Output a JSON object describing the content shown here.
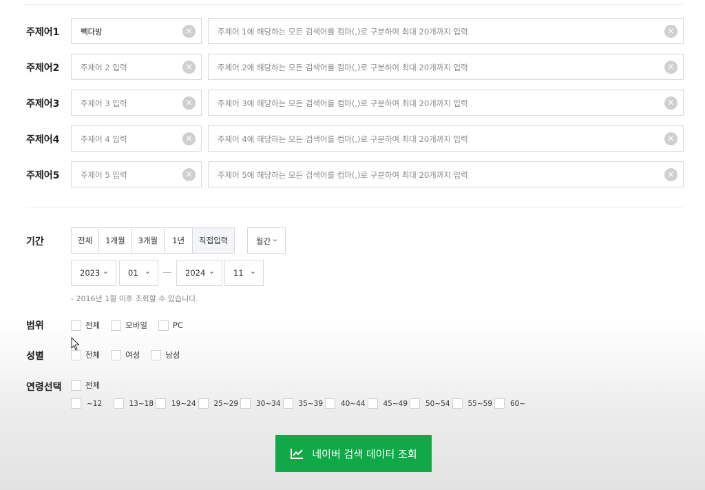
{
  "keywords": [
    {
      "label": "주제어1",
      "topic_value": "빽다방",
      "topic_placeholder": "주제어 1 입력",
      "terms_placeholder": "주제어 1에 해당하는 모든 검색어를 컴마(,)로 구분하여 최대 20개까지 입력"
    },
    {
      "label": "주제어2",
      "topic_value": "",
      "topic_placeholder": "주제어 2 입력",
      "terms_placeholder": "주제어 2에 해당하는 모든 검색어를 컴마(,)로 구분하여 최대 20개까지 입력"
    },
    {
      "label": "주제어3",
      "topic_value": "",
      "topic_placeholder": "주제어 3 입력",
      "terms_placeholder": "주제어 3에 해당하는 모든 검색어를 컴마(,)로 구분하여 최대 20개까지 입력"
    },
    {
      "label": "주제어4",
      "topic_value": "",
      "topic_placeholder": "주제어 4 입력",
      "terms_placeholder": "주제어 4에 해당하는 모든 검색어를 컴마(,)로 구분하여 최대 20개까지 입력"
    },
    {
      "label": "주제어5",
      "topic_value": "",
      "topic_placeholder": "주제어 5 입력",
      "terms_placeholder": "주제어 5에 해당하는 모든 검색어를 컴마(,)로 구분하여 최대 20개까지 입력"
    }
  ],
  "period": {
    "label": "기간",
    "buttons": [
      "전체",
      "1개월",
      "3개월",
      "1년",
      "직접입력"
    ],
    "active": "직접입력",
    "interval": "월간",
    "start_year": "2023",
    "start_month": "01",
    "end_year": "2024",
    "end_month": "11",
    "note": "- 2016년 1월 이후 조회할 수 있습니다."
  },
  "scope": {
    "label": "범위",
    "options": [
      "전체",
      "모바일",
      "PC"
    ]
  },
  "gender": {
    "label": "성별",
    "options": [
      "전체",
      "여성",
      "남성"
    ]
  },
  "age": {
    "label": "연령선택",
    "all": "전체",
    "options": [
      "~12",
      "13~18",
      "19~24",
      "25~29",
      "30~34",
      "35~39",
      "40~44",
      "45~49",
      "50~54",
      "55~59",
      "60~"
    ]
  },
  "search_button": {
    "label": "네이버 검색 데이터 조회",
    "icon": "chart-line-icon",
    "color": "#11a848"
  },
  "icons": {
    "clear": "clear-circle-icon",
    "chevron": "chevron-down-icon",
    "cursor": "mouse-cursor-icon"
  }
}
